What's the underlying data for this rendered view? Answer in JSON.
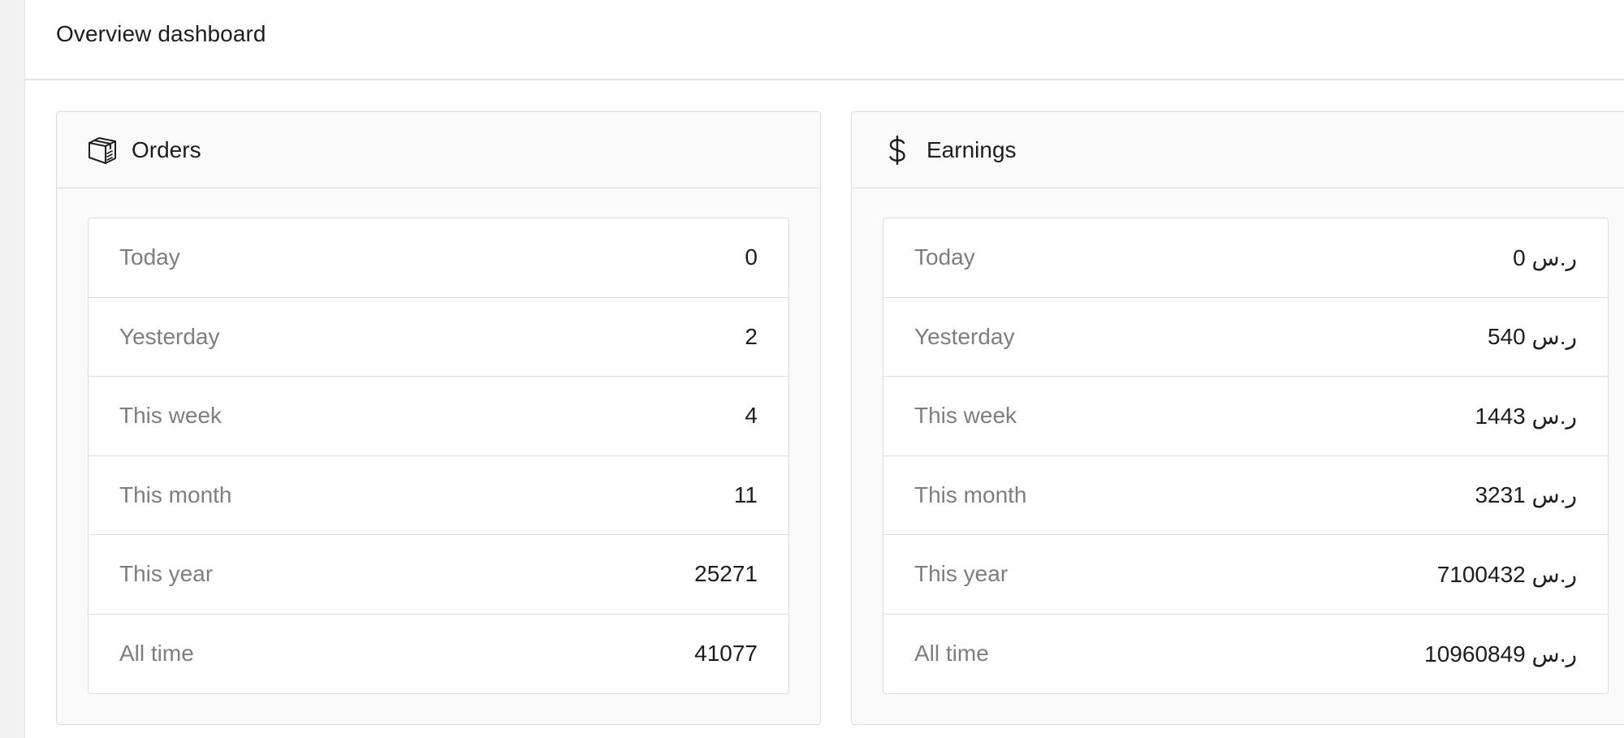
{
  "page": {
    "title": "Overview dashboard"
  },
  "orders": {
    "title": "Orders",
    "icon": "package-icon",
    "rows": [
      {
        "label": "Today",
        "value": "0"
      },
      {
        "label": "Yesterday",
        "value": "2"
      },
      {
        "label": "This week",
        "value": "4"
      },
      {
        "label": "This month",
        "value": "11"
      },
      {
        "label": "This year",
        "value": "25271"
      },
      {
        "label": "All time",
        "value": "41077"
      }
    ]
  },
  "earnings": {
    "title": "Earnings",
    "icon": "dollar-icon",
    "rows": [
      {
        "label": "Today",
        "value": "ر.س 0"
      },
      {
        "label": "Yesterday",
        "value": "ر.س 540"
      },
      {
        "label": "This week",
        "value": "ر.س 1443"
      },
      {
        "label": "This month",
        "value": "ر.س 3231"
      },
      {
        "label": "This year",
        "value": "ر.س 7100432"
      },
      {
        "label": "All time",
        "value": "ر.س 10960849"
      }
    ]
  }
}
